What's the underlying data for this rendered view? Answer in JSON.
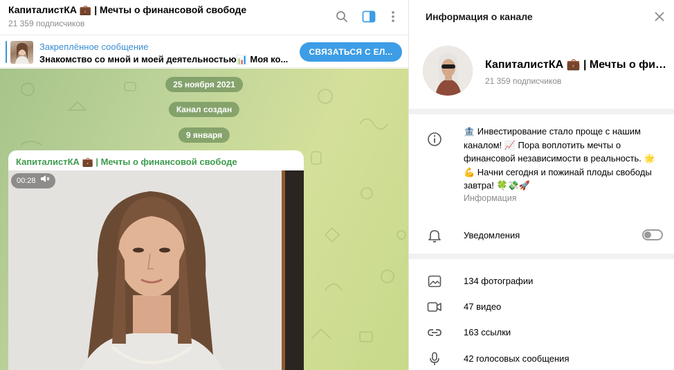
{
  "chat": {
    "title": "КапиталистКА 💼 | Мечты о финансовой свободе",
    "subscribers": "21 359 подписчиков"
  },
  "pinned": {
    "label": "Закреплённое сообщение",
    "text": "Знакомство со мной и моей деятельностью📊 Моя ко...",
    "button": "СВЯЗАТЬСЯ С ЕЛ..."
  },
  "service": {
    "date1": "25 ноября 2021",
    "created": "Канал создан",
    "date2": "9 января"
  },
  "message": {
    "author": "КапиталистКА 💼 | Мечты о финансовой свободе",
    "video_duration": "00:28"
  },
  "info": {
    "title": "Информация о канале",
    "name": "КапиталистКА 💼 | Мечты о финансовой свободе",
    "subscribers": "21 359 подписчиков",
    "description": "🏦 Инвестирование стало проще с нашим каналом! 📈 Пора воплотить мечты о финансовой независимости в реальность. 🌟💪 Начни сегодня и пожинай плоды свободы завтра! 🍀💸🚀",
    "description_label": "Информация",
    "notifications": "Уведомления",
    "notifications_on": false,
    "media": [
      {
        "icon": "photo-icon",
        "label": "134 фотографии"
      },
      {
        "icon": "video-icon",
        "label": "47 видео"
      },
      {
        "icon": "link-icon",
        "label": "163 ссылки"
      },
      {
        "icon": "microphone-icon",
        "label": "42 голосовых сообщения"
      }
    ]
  },
  "colors": {
    "accent": "#3d9de6",
    "author": "#3e9c4e",
    "chat_bg": "#bfd49a"
  }
}
